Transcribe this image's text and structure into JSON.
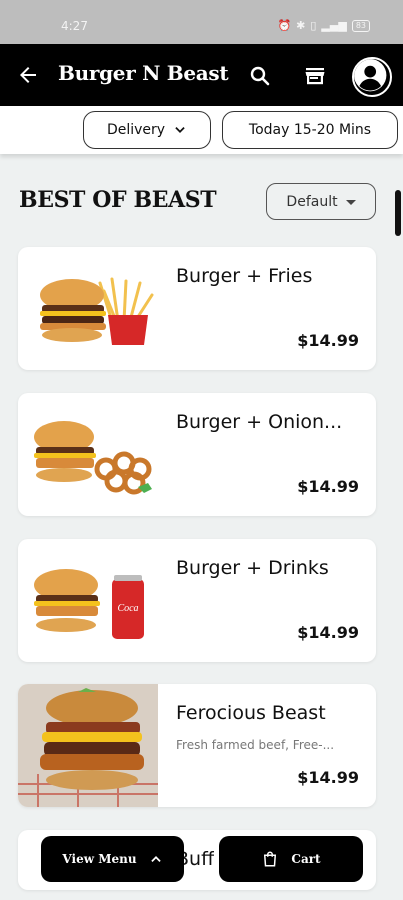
{
  "status_bar": {
    "time": "4:27",
    "battery": "83"
  },
  "app_bar": {
    "title": "Burger N Beast"
  },
  "order_options": {
    "mode": "Delivery",
    "timing": "Today 15-20 Mins"
  },
  "section": {
    "title": "BEST OF BEAST",
    "sort_label": "Default"
  },
  "menu_items": [
    {
      "name": "Burger + Fries",
      "description": "",
      "price": "$14.99"
    },
    {
      "name": "Burger + Onion...",
      "description": "",
      "price": "$14.99"
    },
    {
      "name": "Burger + Drinks",
      "description": "",
      "price": "$14.99"
    },
    {
      "name": "Ferocious Beast",
      "description": "Fresh farmed beef, Free-...",
      "price": "$14.99"
    },
    {
      "name": "Buff",
      "description": "",
      "price": ""
    }
  ],
  "bottom_bar": {
    "view_menu_label": "View Menu",
    "cart_label": "Cart"
  },
  "colors": {
    "app_bar_bg": "#000000",
    "page_bg": "#eef1f1",
    "accent": "#d62828"
  },
  "drink_can_text": "Coca"
}
